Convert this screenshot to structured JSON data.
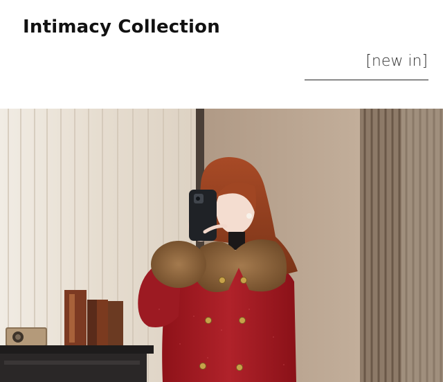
{
  "header": {
    "title": "Intimacy Collection",
    "tag": "[new in]"
  },
  "hero_image": {
    "subject": "woman in red double-breasted wool coat with brown fur collar and cuffs, taking a mirror selfie",
    "colors": {
      "coat": "#a51c24",
      "fur": "#8a6238",
      "wall": "#b8a38f",
      "curtain": "#e8e1d6",
      "hair": "#b4562e"
    }
  }
}
